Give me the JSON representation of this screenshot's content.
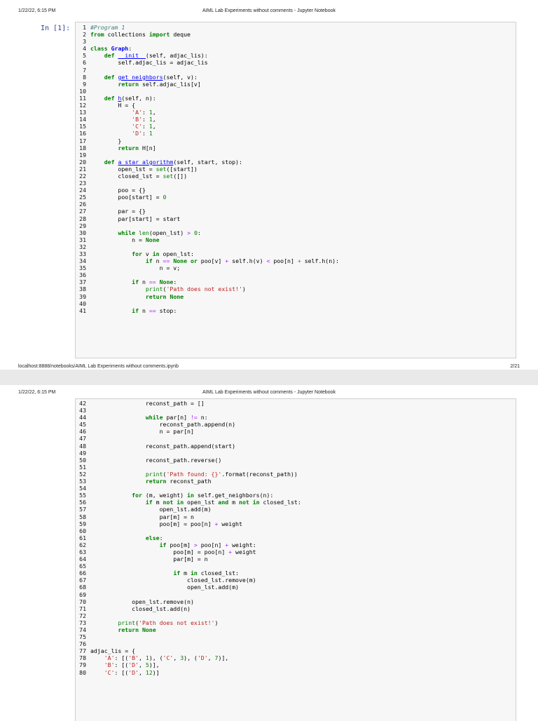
{
  "pages": [
    {
      "header_left": "1/22/22, 6:15 PM",
      "header_center": "AIML Lab Experiments without comments - Jupyter Notebook",
      "footer_left": "localhost:8888/notebooks/AIML Lab Experiments without comments.ipynb",
      "footer_right": "2/21"
    },
    {
      "header_left": "1/22/22, 6:15 PM",
      "header_center": "AIML Lab Experiments without comments - Jupyter Notebook"
    }
  ],
  "cell_prompt": "In [1]:",
  "code_page1": [
    {
      "n": "1",
      "t": "#Program 1"
    },
    {
      "n": "2",
      "t": "from collections import deque"
    },
    {
      "n": "3",
      "t": ""
    },
    {
      "n": "4",
      "t": "class Graph:"
    },
    {
      "n": "5",
      "t": "    def __init__(self, adjac_lis):"
    },
    {
      "n": "6",
      "t": "        self.adjac_lis = adjac_lis"
    },
    {
      "n": "7",
      "t": ""
    },
    {
      "n": "8",
      "t": "    def get_neighbors(self, v):"
    },
    {
      "n": "9",
      "t": "        return self.adjac_lis[v]"
    },
    {
      "n": "10",
      "t": ""
    },
    {
      "n": "11",
      "t": "    def h(self, n):"
    },
    {
      "n": "12",
      "t": "        H = {"
    },
    {
      "n": "13",
      "t": "            'A': 1,"
    },
    {
      "n": "14",
      "t": "            'B': 1,"
    },
    {
      "n": "15",
      "t": "            'C': 1,"
    },
    {
      "n": "16",
      "t": "            'D': 1"
    },
    {
      "n": "17",
      "t": "        }"
    },
    {
      "n": "18",
      "t": "        return H[n]"
    },
    {
      "n": "19",
      "t": ""
    },
    {
      "n": "20",
      "t": "    def a_star_algorithm(self, start, stop):"
    },
    {
      "n": "21",
      "t": "        open_lst = set([start])"
    },
    {
      "n": "22",
      "t": "        closed_lst = set([])"
    },
    {
      "n": "23",
      "t": ""
    },
    {
      "n": "24",
      "t": "        poo = {}"
    },
    {
      "n": "25",
      "t": "        poo[start] = 0"
    },
    {
      "n": "26",
      "t": ""
    },
    {
      "n": "27",
      "t": "        par = {}"
    },
    {
      "n": "28",
      "t": "        par[start] = start"
    },
    {
      "n": "29",
      "t": ""
    },
    {
      "n": "30",
      "t": "        while len(open_lst) > 0:"
    },
    {
      "n": "31",
      "t": "            n = None"
    },
    {
      "n": "32",
      "t": ""
    },
    {
      "n": "33",
      "t": "            for v in open_lst:"
    },
    {
      "n": "34",
      "t": "                if n == None or poo[v] + self.h(v) < poo[n] + self.h(n):"
    },
    {
      "n": "35",
      "t": "                    n = v;"
    },
    {
      "n": "36",
      "t": ""
    },
    {
      "n": "37",
      "t": "            if n == None:"
    },
    {
      "n": "38",
      "t": "                print('Path does not exist!')"
    },
    {
      "n": "39",
      "t": "                return None"
    },
    {
      "n": "40",
      "t": ""
    },
    {
      "n": "41",
      "t": "            if n == stop:"
    }
  ],
  "code_page2": [
    {
      "n": "42",
      "t": "                reconst_path = []"
    },
    {
      "n": "43",
      "t": ""
    },
    {
      "n": "44",
      "t": "                while par[n] != n:"
    },
    {
      "n": "45",
      "t": "                    reconst_path.append(n)"
    },
    {
      "n": "46",
      "t": "                    n = par[n]"
    },
    {
      "n": "47",
      "t": ""
    },
    {
      "n": "48",
      "t": "                reconst_path.append(start)"
    },
    {
      "n": "49",
      "t": ""
    },
    {
      "n": "50",
      "t": "                reconst_path.reverse()"
    },
    {
      "n": "51",
      "t": ""
    },
    {
      "n": "52",
      "t": "                print('Path found: {}'.format(reconst_path))"
    },
    {
      "n": "53",
      "t": "                return reconst_path"
    },
    {
      "n": "54",
      "t": ""
    },
    {
      "n": "55",
      "t": "            for (m, weight) in self.get_neighbors(n):"
    },
    {
      "n": "56",
      "t": "                if m not in open_lst and m not in closed_lst:"
    },
    {
      "n": "57",
      "t": "                    open_lst.add(m)"
    },
    {
      "n": "58",
      "t": "                    par[m] = n"
    },
    {
      "n": "59",
      "t": "                    poo[m] = poo[n] + weight"
    },
    {
      "n": "60",
      "t": ""
    },
    {
      "n": "61",
      "t": "                else:"
    },
    {
      "n": "62",
      "t": "                    if poo[m] > poo[n] + weight:"
    },
    {
      "n": "63",
      "t": "                        poo[m] = poo[n] + weight"
    },
    {
      "n": "64",
      "t": "                        par[m] = n"
    },
    {
      "n": "65",
      "t": ""
    },
    {
      "n": "66",
      "t": "                        if m in closed_lst:"
    },
    {
      "n": "67",
      "t": "                            closed_lst.remove(m)"
    },
    {
      "n": "68",
      "t": "                            open_lst.add(m)"
    },
    {
      "n": "69",
      "t": ""
    },
    {
      "n": "70",
      "t": "            open_lst.remove(n)"
    },
    {
      "n": "71",
      "t": "            closed_lst.add(n)"
    },
    {
      "n": "72",
      "t": ""
    },
    {
      "n": "73",
      "t": "        print('Path does not exist!')"
    },
    {
      "n": "74",
      "t": "        return None"
    },
    {
      "n": "75",
      "t": ""
    },
    {
      "n": "76",
      "t": ""
    },
    {
      "n": "77",
      "t": "adjac_lis = {"
    },
    {
      "n": "78",
      "t": "    'A': [('B', 1), ('C', 3), ('D', 7)],"
    },
    {
      "n": "79",
      "t": "    'B': [('D', 5)],"
    },
    {
      "n": "80",
      "t": "    'C': [('D', 12)]"
    }
  ]
}
